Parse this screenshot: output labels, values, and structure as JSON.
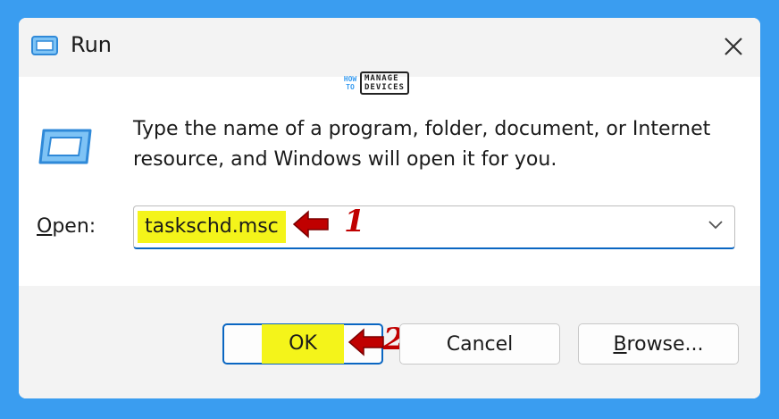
{
  "window": {
    "title": "Run"
  },
  "watermark": {
    "how_to": "HOW TO",
    "line1": "MANAGE",
    "line2": "DEVICES"
  },
  "description": "Type the name of a program, folder, document, or Internet resource, and Windows will open it for you.",
  "open_field": {
    "label_mnemonic": "O",
    "label_rest": "pen:",
    "value": "taskschd.msc"
  },
  "buttons": {
    "ok_label": "OK",
    "cancel_label": "Cancel",
    "browse_mnemonic": "B",
    "browse_rest": "rowse..."
  },
  "annotations": {
    "step1": "1",
    "step2": "2"
  },
  "colors": {
    "background": "#3a9df0",
    "highlight": "#f4f41a",
    "annotation": "#c00000",
    "accent": "#0a66c2"
  },
  "icons": {
    "title": "run-app-icon",
    "program": "run-program-icon",
    "close": "close-icon",
    "dropdown": "chevron-down-icon",
    "annotation_arrow": "red-arrow-left-icon"
  }
}
